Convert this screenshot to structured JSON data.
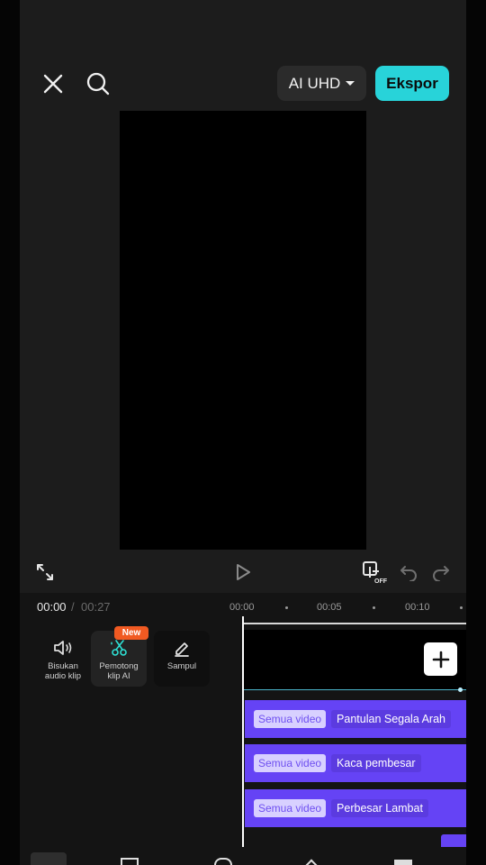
{
  "header": {
    "resolution_label": "AI UHD",
    "export_label": "Ekspor"
  },
  "player": {
    "current_time": "00:00",
    "separator": "/",
    "total_time": "00:27"
  },
  "ruler": {
    "labels": [
      "00:00",
      "00:05",
      "00:10"
    ]
  },
  "tools": {
    "mute_label_line1": "Bisukan",
    "mute_label_line2": "audio klip",
    "cutter_label_line1": "Pemotong",
    "cutter_label_line2": "klip AI",
    "cutter_badge": "New",
    "cover_label": "Sampul"
  },
  "effects": [
    {
      "tag": "Semua video",
      "name": "Pantulan Segala Arah"
    },
    {
      "tag": "Semua video",
      "name": "Kaca pembesar"
    },
    {
      "tag": "Semua video",
      "name": "Perbesar Lambat"
    }
  ],
  "colors": {
    "accent": "#28d3d9",
    "effect_track": "#6543f5",
    "badge": "#f15a22"
  },
  "icons": [
    "close-icon",
    "search-icon",
    "caret-down-icon",
    "fullscreen-icon",
    "play-icon",
    "keyframe-off-icon",
    "undo-icon",
    "redo-icon",
    "speaker-icon",
    "ai-scissors-icon",
    "pencil-icon",
    "plus-icon"
  ]
}
